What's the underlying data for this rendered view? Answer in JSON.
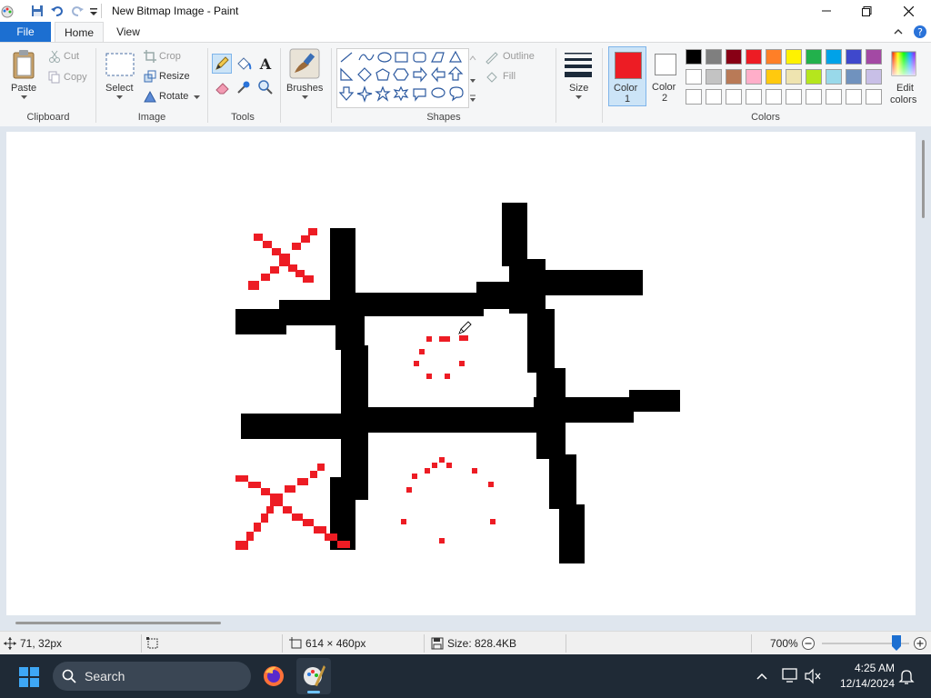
{
  "app": {
    "window_title": "New Bitmap Image - Paint"
  },
  "tabs": {
    "file": "File",
    "home": "Home",
    "view": "View"
  },
  "ribbon": {
    "clipboard": {
      "paste": "Paste",
      "cut": "Cut",
      "copy": "Copy",
      "group": "Clipboard"
    },
    "image": {
      "select": "Select",
      "crop": "Crop",
      "resize": "Resize",
      "rotate": "Rotate",
      "group": "Image"
    },
    "tools": {
      "group": "Tools",
      "text_glyph": "A"
    },
    "brushes": {
      "label": "Brushes"
    },
    "shapes": {
      "outline": "Outline",
      "fill": "Fill",
      "group": "Shapes"
    },
    "size": {
      "label": "Size"
    },
    "colors": {
      "color1": "Color",
      "color1_num": "1",
      "color2": "Color",
      "color2_num": "2",
      "edit_colors_1": "Edit",
      "edit_colors_2": "colors",
      "group": "Colors",
      "color1_value": "#ed1c24",
      "color2_value": "#ffffff",
      "palette_row1": [
        "#000000",
        "#7f7f7f",
        "#880015",
        "#ed1c24",
        "#ff7f27",
        "#fff200",
        "#22b14c",
        "#00a2e8",
        "#3f48cc",
        "#a349a4"
      ],
      "palette_row2": [
        "#ffffff",
        "#c3c3c3",
        "#b97a57",
        "#ffaec9",
        "#ffc90e",
        "#efe4b0",
        "#b5e61d",
        "#99d9ea",
        "#7092be",
        "#c8bfe7"
      ],
      "palette_row3": [
        "#ffffff",
        "#ffffff",
        "#ffffff",
        "#ffffff",
        "#ffffff",
        "#ffffff",
        "#ffffff",
        "#ffffff",
        "#ffffff",
        "#ffffff"
      ]
    }
  },
  "status": {
    "cursor_pos": "71, 32px",
    "dimensions": "614 × 460px",
    "size": "Size: 828.4KB",
    "zoom": "700%",
    "zoom_level_fraction": 0.85
  },
  "taskbar": {
    "search_placeholder": "Search",
    "time": "4:25 AM",
    "date": "12/14/2024"
  }
}
